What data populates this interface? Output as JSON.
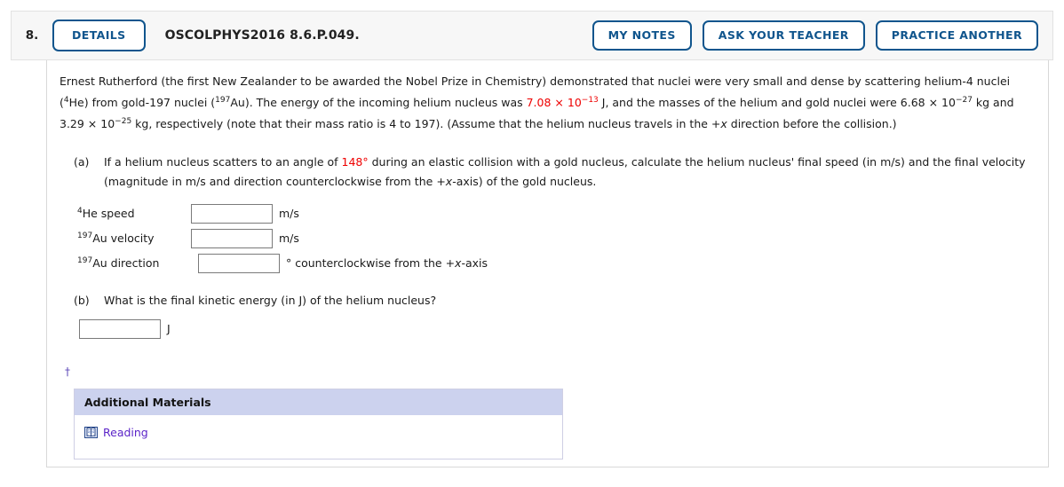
{
  "header": {
    "question_number": "8.",
    "details_label": "DETAILS",
    "question_code": "OSCOLPHYS2016 8.6.P.049.",
    "actions": [
      {
        "label": "MY NOTES",
        "name": "my-notes-button"
      },
      {
        "label": "ASK YOUR TEACHER",
        "name": "ask-your-teacher-button"
      },
      {
        "label": "PRACTICE ANOTHER",
        "name": "practice-another-button"
      }
    ],
    "accent_color": "#10558d",
    "background_color": "#f7f7f7"
  },
  "stem": {
    "s1": "Ernest Rutherford (the first New Zealander to be awarded the Nobel Prize in Chemistry) demonstrated that nuclei were very small and dense by scattering helium-4 nuclei (",
    "he_mass": "4",
    "s2": "He) from gold-197 nuclei (",
    "au_mass": "197",
    "s3": "Au). The energy of the incoming helium nucleus was ",
    "energy_value": "7.08 × 10",
    "energy_exp": "−13",
    "s4": " J, and the masses of the helium and gold nuclei were ",
    "mass_he": "6.68 × 10",
    "mass_he_exp": "−27",
    "s5": " kg and ",
    "mass_au": "3.29 × 10",
    "mass_au_exp": "−25",
    "s6": " kg, respectively (note that their mass ratio is 4 to 197). (Assume that the helium nucleus travels in the ",
    "plus_x": "+x",
    "s7": " direction before the collision.)"
  },
  "parts": [
    {
      "label": "(a)",
      "text_before_angle": "If a helium nucleus scatters to an angle of ",
      "angle": "148°",
      "text_after_angle": " during an elastic collision with a gold nucleus, calculate the helium nucleus' final speed (in m/s) and the final velocity (magnitude in m/s and direction counterclockwise from the ",
      "axis": "+x",
      "text_end": "-axis) of the gold nucleus.",
      "answers": [
        {
          "sup": "4",
          "label": "He speed",
          "value": "",
          "placeholder": "",
          "unit": "m/s",
          "name": "he-speed-input"
        },
        {
          "sup": "197",
          "label": "Au velocity",
          "value": "",
          "placeholder": "",
          "unit": "m/s",
          "name": "au-velocity-input"
        },
        {
          "sup": "197",
          "label": "Au direction",
          "value": "",
          "placeholder": "",
          "unit_pre": "° counterclockwise from the ",
          "unit_axis": "+x",
          "unit_post": "-axis",
          "name": "au-direction-input"
        }
      ]
    },
    {
      "label": "(b)",
      "text": "What is the final kinetic energy (in J) of the helium nucleus?",
      "answer": {
        "value": "",
        "placeholder": "",
        "unit": "J",
        "name": "kinetic-energy-input"
      }
    }
  ],
  "footnote": {
    "symbol": "†",
    "color": "#5b46b8"
  },
  "additional_materials": {
    "title": "Additional Materials",
    "header_color": "#ccd2ee",
    "items": [
      {
        "label": "Reading",
        "icon": "book-icon",
        "color": "#5b24c8"
      }
    ]
  }
}
